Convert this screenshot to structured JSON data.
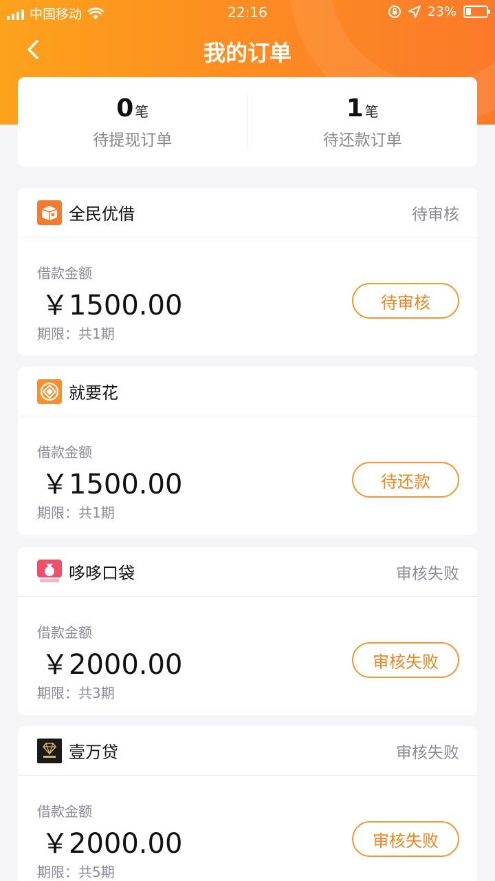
{
  "status_bar": {
    "carrier": "中国移动",
    "time": "22:16",
    "battery": "23%"
  },
  "header": {
    "title": "我的订单"
  },
  "summary": [
    {
      "count": "0",
      "unit": "笔",
      "label": "待提现订单"
    },
    {
      "count": "1",
      "unit": "笔",
      "label": "待还款订单"
    }
  ],
  "amount_label": "借款金额",
  "orders": [
    {
      "name": "全民优借",
      "status": "待审核",
      "amount": "￥1500.00",
      "term": "期限：共1期",
      "button": "待审核",
      "logo_icon": "box-icon",
      "logo_color": "#f47a30"
    },
    {
      "name": "就要花",
      "status": "",
      "amount": "￥1500.00",
      "term": "期限：共1期",
      "button": "待还款",
      "logo_icon": "diamond-coin-icon",
      "logo_color": "#f5902a"
    },
    {
      "name": "哆哆口袋",
      "status": "审核失败",
      "amount": "￥2000.00",
      "term": "期限：共3期",
      "button": "审核失败",
      "logo_icon": "money-bag-icon",
      "logo_color": "#f24d6b"
    },
    {
      "name": "壹万贷",
      "status": "审核失败",
      "amount": "￥2000.00",
      "term": "期限：共5期",
      "button": "审核失败",
      "logo_icon": "gem-icon",
      "logo_color": "#1a1a1a"
    }
  ],
  "colors": {
    "accent": "#f7962c",
    "header_start": "#fda21b",
    "header_end": "#fb7a2a"
  }
}
